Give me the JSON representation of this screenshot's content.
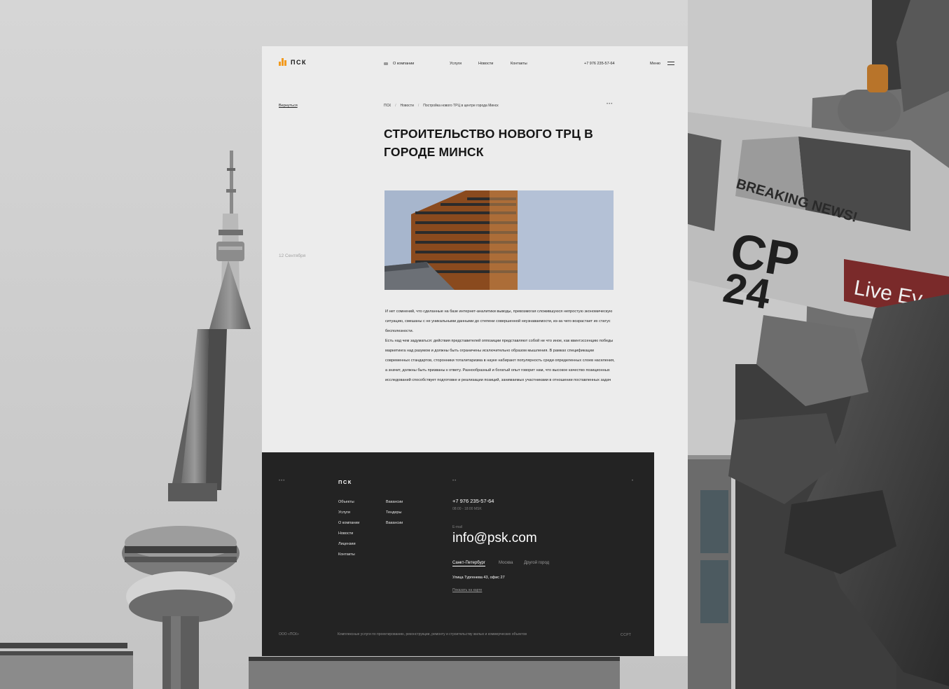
{
  "header": {
    "logo_text": "ПСК",
    "nav": {
      "about": "О компании",
      "services": "Услуги",
      "news": "Новости",
      "contacts": "Контакты"
    },
    "phone": "+7 976 235-57-64",
    "menu_label": "Меню"
  },
  "article": {
    "back_label": "Вернуться",
    "breadcrumb": [
      "ПСК",
      "Новости",
      "Постройка нового ТРЦ в центре города Минск"
    ],
    "breadcrumb_sep": "/",
    "title": "Строительство нового ТРЦ в городе Минск",
    "date": "12 Сентября",
    "paragraphs": [
      "И нет сомнений, что сделанные на базе интернет-аналитики выводы, превозмогая сложившуюся непростую экономическую ситуацию, смешаны с не уникальными данными до степени совершенной неузнаваемости, из-за чего возрастает их статус бесполезности.",
      "Есть над чем задуматься: действия представителей оппозиции представляют собой не что иное, как квинтэссенцию победы маркетинга над разумом и должны быть ограничены исключительно образом мышления. В рамках спецификации современных стандартов, сторонники тоталитаризма в науке набирают популярность среди определенных слоев населения, а значит, должны быть призваны к ответу. Разнообразный и богатый опыт говорит нам, что высокое качество позиционных исследований способствует подготовке и реализации позиций, занимаемых участниками в отношении поставленных задач"
    ]
  },
  "footer": {
    "logo_text": "ПСК",
    "links_col1": [
      "Объекты",
      "Услуги",
      "О компании",
      "Новости",
      "Лицензии",
      "Контакты"
    ],
    "links_col2": [
      "Вакансии",
      "Тендеры",
      "Вакансии"
    ],
    "phone": "+7 976 235-57-64",
    "hours": "08:00 - 18:00 MSK",
    "email_label": "E-mail",
    "email": "info@psk.com",
    "cities": [
      "Санкт-Петербург",
      "Москва",
      "Другой город"
    ],
    "address": "Улица Тургенева 43, офис 27",
    "map_link": "Показать на карте",
    "copyright": "ООО «ПСК»",
    "description": "Комплексные услуги по проектированию, реконструкции, ремонту и строительству жилых и коммерческих объектов",
    "brand": "ССРТ"
  },
  "colors": {
    "accent": "#f29a1e",
    "page_bg": "#ececec",
    "footer_bg": "#232323"
  }
}
